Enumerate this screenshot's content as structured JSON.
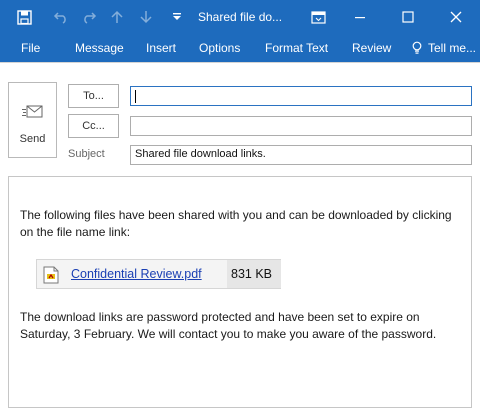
{
  "window": {
    "title": "Shared file do..."
  },
  "tabs": [
    {
      "label": "File"
    },
    {
      "label": "Message"
    },
    {
      "label": "Insert"
    },
    {
      "label": "Options"
    },
    {
      "label": "Format Text"
    },
    {
      "label": "Review"
    },
    {
      "label": "Tell me..."
    }
  ],
  "compose": {
    "send_label": "Send",
    "to_label": "To...",
    "cc_label": "Cc...",
    "subject_label": "Subject",
    "to_value": "",
    "cc_value": "",
    "subject_value": "Shared file download links."
  },
  "body": {
    "paragraph1": "The following files have been shared with you and can be downloaded by clicking on the file name link:",
    "attachment": {
      "name": "Confidential Review.pdf",
      "size": "831 KB"
    },
    "paragraph2": "The download links are password protected and have been set to expire on Saturday, 3 February. We will contact you to make you aware of the password."
  },
  "colors": {
    "accent": "#1e6bbd",
    "link": "#1a3fb3"
  },
  "icons": [
    "save-icon",
    "undo-icon",
    "redo-icon",
    "up-arrow-icon",
    "down-arrow-icon",
    "customize-toolbar-icon",
    "ribbon-display-icon",
    "minimize-icon",
    "maximize-icon",
    "close-icon",
    "lightbulb-icon",
    "send-icon",
    "pdf-file-icon"
  ]
}
